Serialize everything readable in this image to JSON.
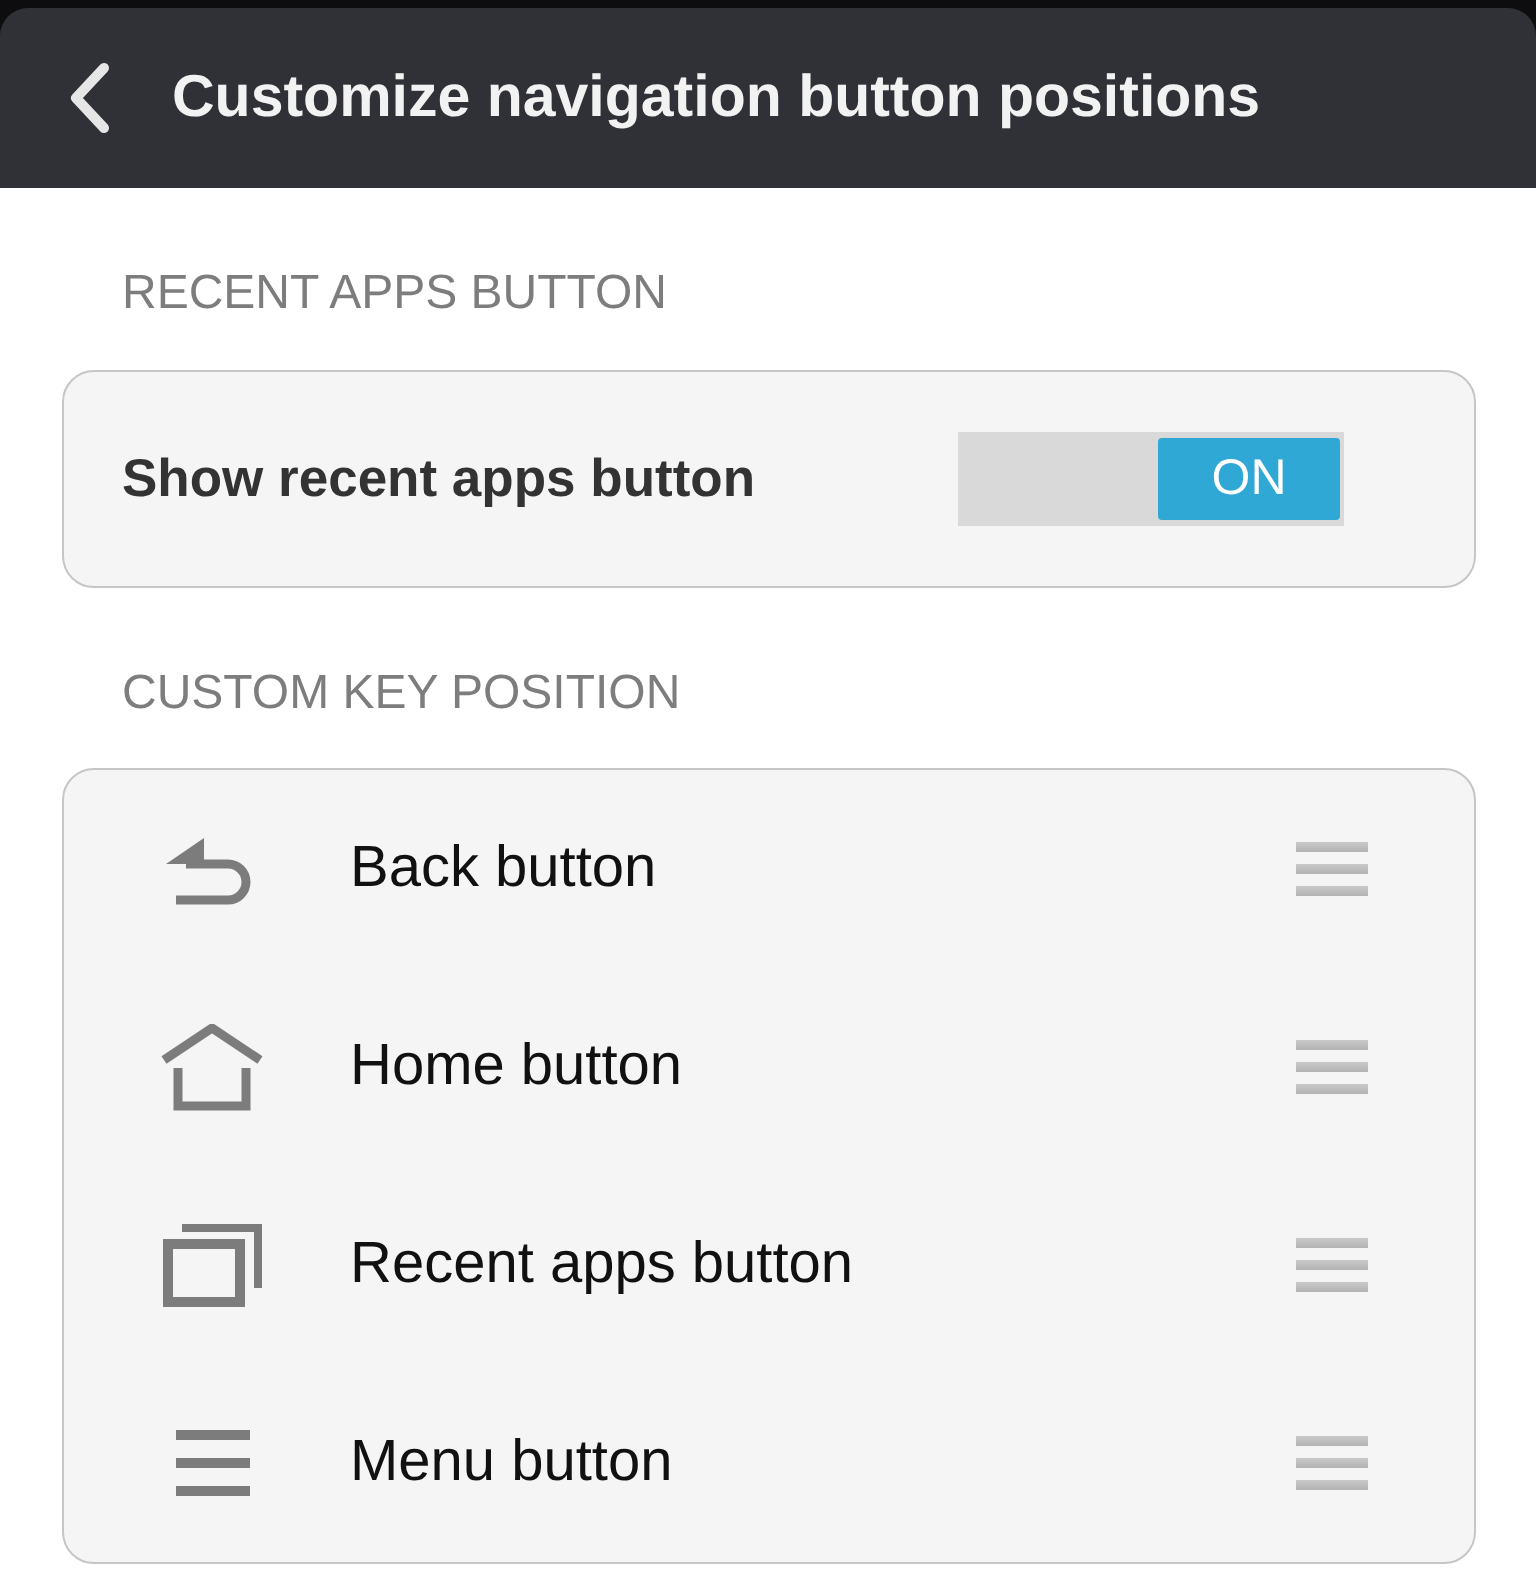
{
  "header": {
    "title": "Customize navigation button positions"
  },
  "recent_apps_section": {
    "heading": "RECENT APPS BUTTON",
    "setting": {
      "label": "Show recent apps button",
      "on": true,
      "toggle_label": "ON"
    }
  },
  "custom_key_section": {
    "heading": "CUSTOM KEY POSITION",
    "keys": [
      {
        "kind": "back",
        "label": "Back button"
      },
      {
        "kind": "home",
        "label": "Home button"
      },
      {
        "kind": "recent",
        "label": "Recent apps button"
      },
      {
        "kind": "menu",
        "label": "Menu button"
      }
    ]
  }
}
